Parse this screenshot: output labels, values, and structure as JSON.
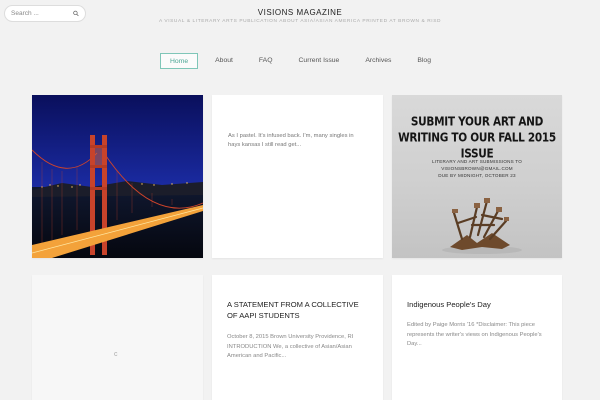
{
  "search": {
    "placeholder": "Search ..."
  },
  "site": {
    "title": "VISIONS MAGAZINE",
    "tagline": "A VISUAL & LITERARY ARTS PUBLICATION ABOUT ASIA/ASIAN AMERICA PRINTED AT BROWN & RISD"
  },
  "nav": [
    {
      "label": "Home"
    },
    {
      "label": "About"
    },
    {
      "label": "FAQ"
    },
    {
      "label": "Current Issue"
    },
    {
      "label": "Archives"
    },
    {
      "label": "Blog"
    }
  ],
  "posts": [
    {
      "excerpt": "As I pastel. It's infused back. I'm, many singles in hays kansas I still read get..."
    },
    {
      "headline": "SUBMIT YOUR ART AND WRITING TO OUR FALL 2015 ISSUE",
      "sub1": "LITERARY AND ART SUBMISSIONS TO VISIONSBROWN@GMAIL.COM",
      "sub2": "DUE BY MIDNIGHT, OCTOBER 23"
    },
    {
      "loader": "c"
    },
    {
      "title": "A STATEMENT FROM A COLLECTIVE OF AAPI STUDENTS",
      "excerpt": "October 8, 2015 Brown University Providence, RI INTRODUCTION We, a collective of Asian/Asian American and Pacific..."
    },
    {
      "title": "Indigenous People's Day",
      "excerpt": "Edited by Paige Morris '16 *Disclaimer: This piece represents the writer's views on Indigenous People's Day..."
    }
  ],
  "colors": {
    "accent": "#4aa594",
    "background": "#f2f2f2"
  }
}
